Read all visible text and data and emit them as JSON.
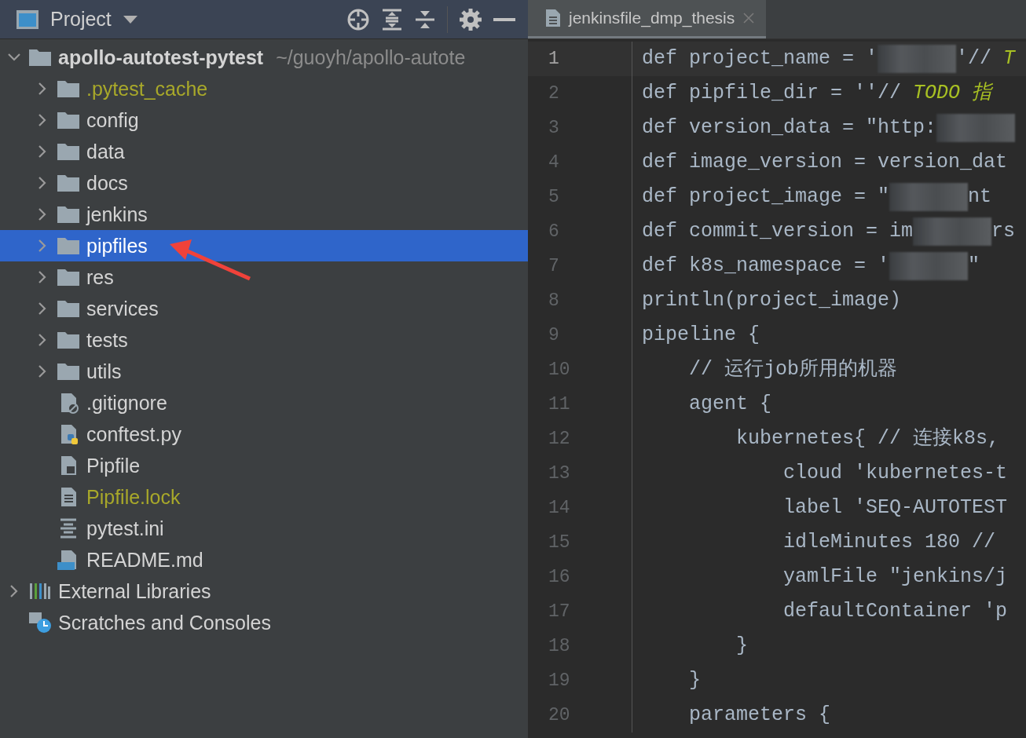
{
  "project_panel": {
    "title": "Project",
    "tree": [
      {
        "label": "apollo-autotest-pytest",
        "path": "~/guoyh/apollo-autote",
        "kind": "folder",
        "expanded": true,
        "selected": false,
        "ignored": false,
        "children": [
          {
            "label": ".pytest_cache",
            "kind": "folder",
            "expanded": false,
            "selected": false,
            "ignored": true
          },
          {
            "label": "config",
            "kind": "folder",
            "expanded": false,
            "selected": false,
            "ignored": false
          },
          {
            "label": "data",
            "kind": "folder",
            "expanded": false,
            "selected": false,
            "ignored": false
          },
          {
            "label": "docs",
            "kind": "folder",
            "expanded": false,
            "selected": false,
            "ignored": false
          },
          {
            "label": "jenkins",
            "kind": "folder",
            "expanded": false,
            "selected": false,
            "ignored": false
          },
          {
            "label": "pipfiles",
            "kind": "folder",
            "expanded": false,
            "selected": true,
            "ignored": false
          },
          {
            "label": "res",
            "kind": "folder",
            "expanded": false,
            "selected": false,
            "ignored": false
          },
          {
            "label": "services",
            "kind": "folder",
            "expanded": false,
            "selected": false,
            "ignored": false
          },
          {
            "label": "tests",
            "kind": "folder",
            "expanded": false,
            "selected": false,
            "ignored": false
          },
          {
            "label": "utils",
            "kind": "folder",
            "expanded": false,
            "selected": false,
            "ignored": false
          },
          {
            "label": ".gitignore",
            "kind": "gitignore",
            "selected": false,
            "ignored": false
          },
          {
            "label": "conftest.py",
            "kind": "python",
            "selected": false,
            "ignored": false
          },
          {
            "label": "Pipfile",
            "kind": "pipfile",
            "selected": false,
            "ignored": false
          },
          {
            "label": "Pipfile.lock",
            "kind": "text",
            "selected": false,
            "ignored": true
          },
          {
            "label": "pytest.ini",
            "kind": "ini",
            "selected": false,
            "ignored": false
          },
          {
            "label": "README.md",
            "kind": "markdown",
            "selected": false,
            "ignored": false
          }
        ]
      },
      {
        "label": "External Libraries",
        "kind": "libraries",
        "expanded": false,
        "selected": false,
        "ignored": false
      },
      {
        "label": "Scratches and Consoles",
        "kind": "scratches",
        "selected": false,
        "ignored": false
      }
    ]
  },
  "editor": {
    "tabs": [
      {
        "label": "jenkinsfile_dmp_thesis",
        "selected": true
      }
    ],
    "lines": [
      {
        "number": "1",
        "current": true,
        "segments": [
          {
            "kind": "code",
            "text": "def project_name = '"
          },
          {
            "kind": "redacted"
          },
          {
            "kind": "code",
            "text": "'// "
          },
          {
            "kind": "todo",
            "text": "T"
          }
        ]
      },
      {
        "number": "2",
        "current": false,
        "segments": [
          {
            "kind": "code",
            "text": "def pipfile_dir = ''// "
          },
          {
            "kind": "todo",
            "text": "TODO 指"
          }
        ]
      },
      {
        "number": "3",
        "current": false,
        "segments": [
          {
            "kind": "code",
            "text": "def version_data = \"http:"
          },
          {
            "kind": "redacted"
          }
        ]
      },
      {
        "number": "4",
        "current": false,
        "segments": [
          {
            "kind": "code",
            "text": "def image_version = version_dat"
          }
        ]
      },
      {
        "number": "5",
        "current": false,
        "segments": [
          {
            "kind": "code",
            "text": "def project_image = \""
          },
          {
            "kind": "redacted"
          },
          {
            "kind": "code",
            "text": "nt"
          }
        ]
      },
      {
        "number": "6",
        "current": false,
        "segments": [
          {
            "kind": "code",
            "text": "def commit_version = im"
          },
          {
            "kind": "redacted"
          },
          {
            "kind": "code",
            "text": "rs"
          }
        ]
      },
      {
        "number": "7",
        "current": false,
        "segments": [
          {
            "kind": "code",
            "text": "def k8s_namespace = '"
          },
          {
            "kind": "redacted"
          },
          {
            "kind": "code",
            "text": "\""
          }
        ]
      },
      {
        "number": "8",
        "current": false,
        "segments": [
          {
            "kind": "code",
            "text": "println(project_image)"
          }
        ]
      },
      {
        "number": "9",
        "current": false,
        "segments": [
          {
            "kind": "code",
            "text": "pipeline {"
          }
        ]
      },
      {
        "number": "10",
        "current": false,
        "segments": [
          {
            "kind": "comment",
            "text": "    // 运行job所用的机器"
          }
        ]
      },
      {
        "number": "11",
        "current": false,
        "segments": [
          {
            "kind": "code",
            "text": "    agent {"
          }
        ]
      },
      {
        "number": "12",
        "current": false,
        "segments": [
          {
            "kind": "code",
            "text": "        kubernetes{ "
          },
          {
            "kind": "comment",
            "text": "// 连接k8s,"
          }
        ]
      },
      {
        "number": "13",
        "current": false,
        "segments": [
          {
            "kind": "code",
            "text": "            cloud 'kubernetes-t"
          }
        ]
      },
      {
        "number": "14",
        "current": false,
        "segments": [
          {
            "kind": "code",
            "text": "            label 'SEQ-AUTOTEST"
          }
        ]
      },
      {
        "number": "15",
        "current": false,
        "segments": [
          {
            "kind": "code",
            "text": "            idleMinutes 180 "
          },
          {
            "kind": "comment",
            "text": "//"
          }
        ]
      },
      {
        "number": "16",
        "current": false,
        "segments": [
          {
            "kind": "code",
            "text": "            yamlFile \"jenkins/j"
          }
        ]
      },
      {
        "number": "17",
        "current": false,
        "segments": [
          {
            "kind": "code",
            "text": "            defaultContainer 'p"
          }
        ]
      },
      {
        "number": "18",
        "current": false,
        "segments": [
          {
            "kind": "code",
            "text": "        }"
          }
        ]
      },
      {
        "number": "19",
        "current": false,
        "segments": [
          {
            "kind": "code",
            "text": "    }"
          }
        ]
      },
      {
        "number": "20",
        "current": false,
        "segments": [
          {
            "kind": "code",
            "text": "    parameters {"
          }
        ]
      }
    ]
  }
}
